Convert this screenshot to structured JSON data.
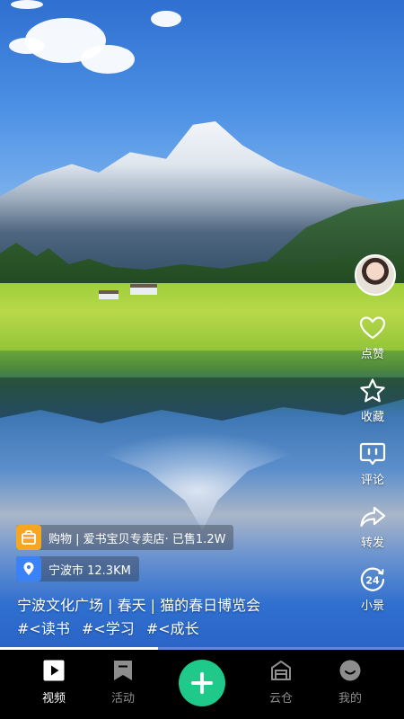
{
  "actions": {
    "like": {
      "label": "点赞",
      "icon": "heart-icon"
    },
    "favorite": {
      "label": "收藏",
      "icon": "star-icon"
    },
    "comment": {
      "label": "评论",
      "icon": "comment-icon"
    },
    "share": {
      "label": "转发",
      "icon": "share-arrow-icon"
    },
    "scene": {
      "label": "小景",
      "icon": "24h-icon",
      "icon_text": "24"
    }
  },
  "shop_tag": {
    "icon": "shopping-bag-icon",
    "text": "购物 | 爱书宝贝专卖店· 已售1.2W",
    "color": "#f5a623"
  },
  "location_tag": {
    "icon": "location-pin-icon",
    "text": "宁波市 12.3KM",
    "color": "#3b82f6"
  },
  "video": {
    "title": "宁波文化广场 | 春天 | 猫的春日博览会",
    "hashtags": [
      "#<读书",
      "#<学习",
      "#<成长"
    ],
    "progress": 0.39
  },
  "tabbar": {
    "tabs": [
      {
        "label": "视频",
        "icon": "play-video-icon",
        "active": true
      },
      {
        "label": "活动",
        "icon": "bookmark-icon",
        "active": false
      },
      {
        "label": "云仓",
        "icon": "warehouse-icon",
        "active": false
      },
      {
        "label": "我的",
        "icon": "smiley-face-icon",
        "active": false
      }
    ],
    "plus_icon": "plus-icon",
    "accent": "#1ec98a"
  }
}
